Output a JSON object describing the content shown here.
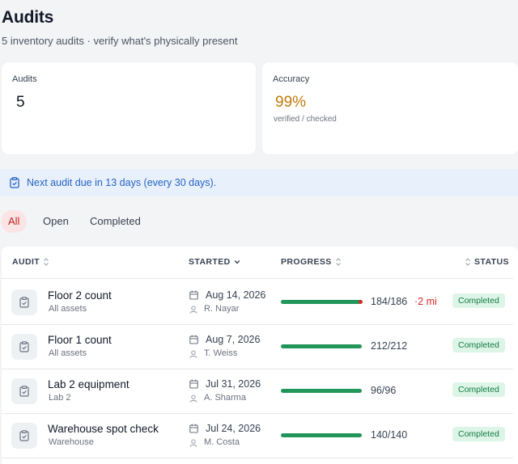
{
  "header": {
    "title": "Audits",
    "subtitle": "5 inventory audits · verify what's physically present"
  },
  "stats": {
    "audits": {
      "label": "Audits",
      "value": "5"
    },
    "accuracy": {
      "label": "Accuracy",
      "value": "99%",
      "hint": "verified / checked",
      "color": "#c2780a"
    }
  },
  "banner": {
    "text": "Next audit due in 13 days (every 30 days).",
    "icon": "clipboard-icon"
  },
  "tabs": [
    {
      "label": "All",
      "active": true
    },
    {
      "label": "Open",
      "active": false
    },
    {
      "label": "Completed",
      "active": false
    }
  ],
  "table": {
    "columns": {
      "audit": "AUDIT",
      "started": "STARTED",
      "progress": "PROGRESS",
      "status": "STATUS"
    },
    "rows": [
      {
        "name": "Floor 2 count",
        "scope": "All assets",
        "date": "Aug 14, 2026",
        "user": "R. Nayar",
        "checked": 184,
        "total": 186,
        "count": "184/186",
        "missing": "·2 mi",
        "status": "Completed"
      },
      {
        "name": "Floor 1 count",
        "scope": "All assets",
        "date": "Aug 7, 2026",
        "user": "T. Weiss",
        "checked": 212,
        "total": 212,
        "count": "212/212",
        "missing": "",
        "status": "Completed"
      },
      {
        "name": "Lab 2 equipment",
        "scope": "Lab 2",
        "date": "Jul 31, 2026",
        "user": "A. Sharma",
        "checked": 96,
        "total": 96,
        "count": "96/96",
        "missing": "",
        "status": "Completed"
      },
      {
        "name": "Warehouse spot check",
        "scope": "Warehouse",
        "date": "Jul 24, 2026",
        "user": "M. Costa",
        "checked": 140,
        "total": 140,
        "count": "140/140",
        "missing": "",
        "status": "Completed"
      }
    ]
  },
  "colors": {
    "accent": "#c02626",
    "progress": "#22965a",
    "badge_bg": "#dcf5e6",
    "badge_text": "#147a44",
    "banner_bg": "#e8f0fc"
  }
}
